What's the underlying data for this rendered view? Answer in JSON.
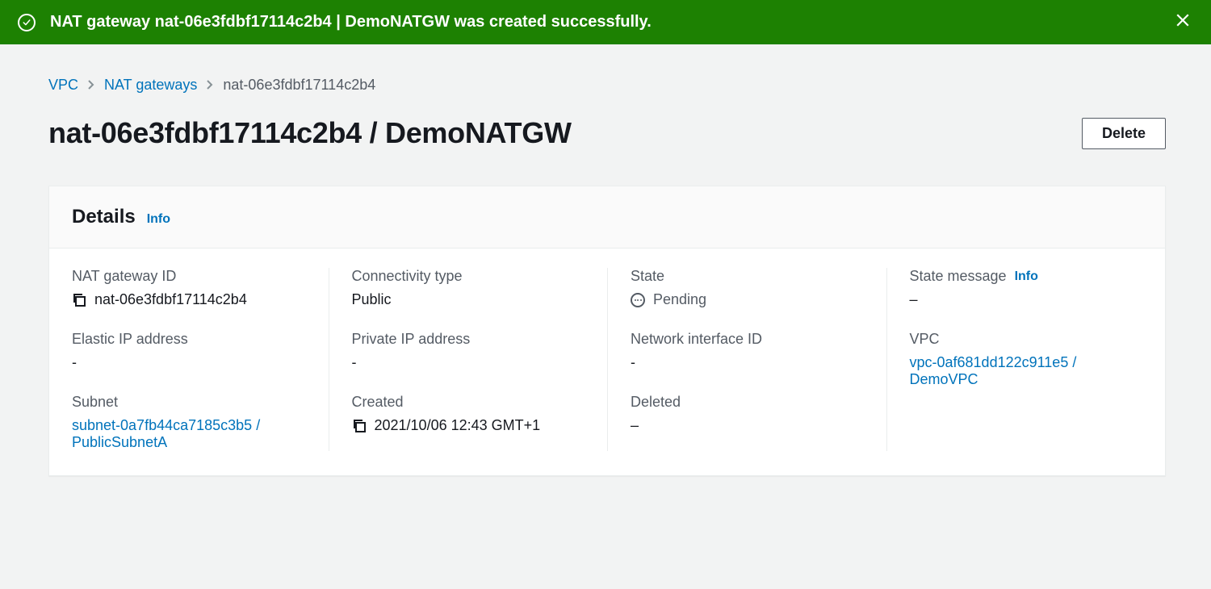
{
  "banner": {
    "message": "NAT gateway nat-06e3fdbf17114c2b4 | DemoNATGW was created successfully."
  },
  "breadcrumb": {
    "items": [
      "VPC",
      "NAT gateways",
      "nat-06e3fdbf17114c2b4"
    ]
  },
  "header": {
    "title": "nat-06e3fdbf17114c2b4 / DemoNATGW",
    "delete_label": "Delete"
  },
  "card": {
    "title": "Details",
    "info_label": "Info"
  },
  "details": {
    "nat_gateway_id": {
      "label": "NAT gateway ID",
      "value": "nat-06e3fdbf17114c2b4"
    },
    "connectivity_type": {
      "label": "Connectivity type",
      "value": "Public"
    },
    "state": {
      "label": "State",
      "value": "Pending"
    },
    "state_message": {
      "label": "State message",
      "info_label": "Info",
      "value": "–"
    },
    "elastic_ip": {
      "label": "Elastic IP address",
      "value": "-"
    },
    "private_ip": {
      "label": "Private IP address",
      "value": "-"
    },
    "network_interface_id": {
      "label": "Network interface ID",
      "value": "-"
    },
    "vpc": {
      "label": "VPC",
      "value": "vpc-0af681dd122c911e5 / DemoVPC"
    },
    "subnet": {
      "label": "Subnet",
      "value": "subnet-0a7fb44ca7185c3b5 / PublicSubnetA"
    },
    "created": {
      "label": "Created",
      "value": "2021/10/06 12:43 GMT+1"
    },
    "deleted": {
      "label": "Deleted",
      "value": "–"
    }
  }
}
